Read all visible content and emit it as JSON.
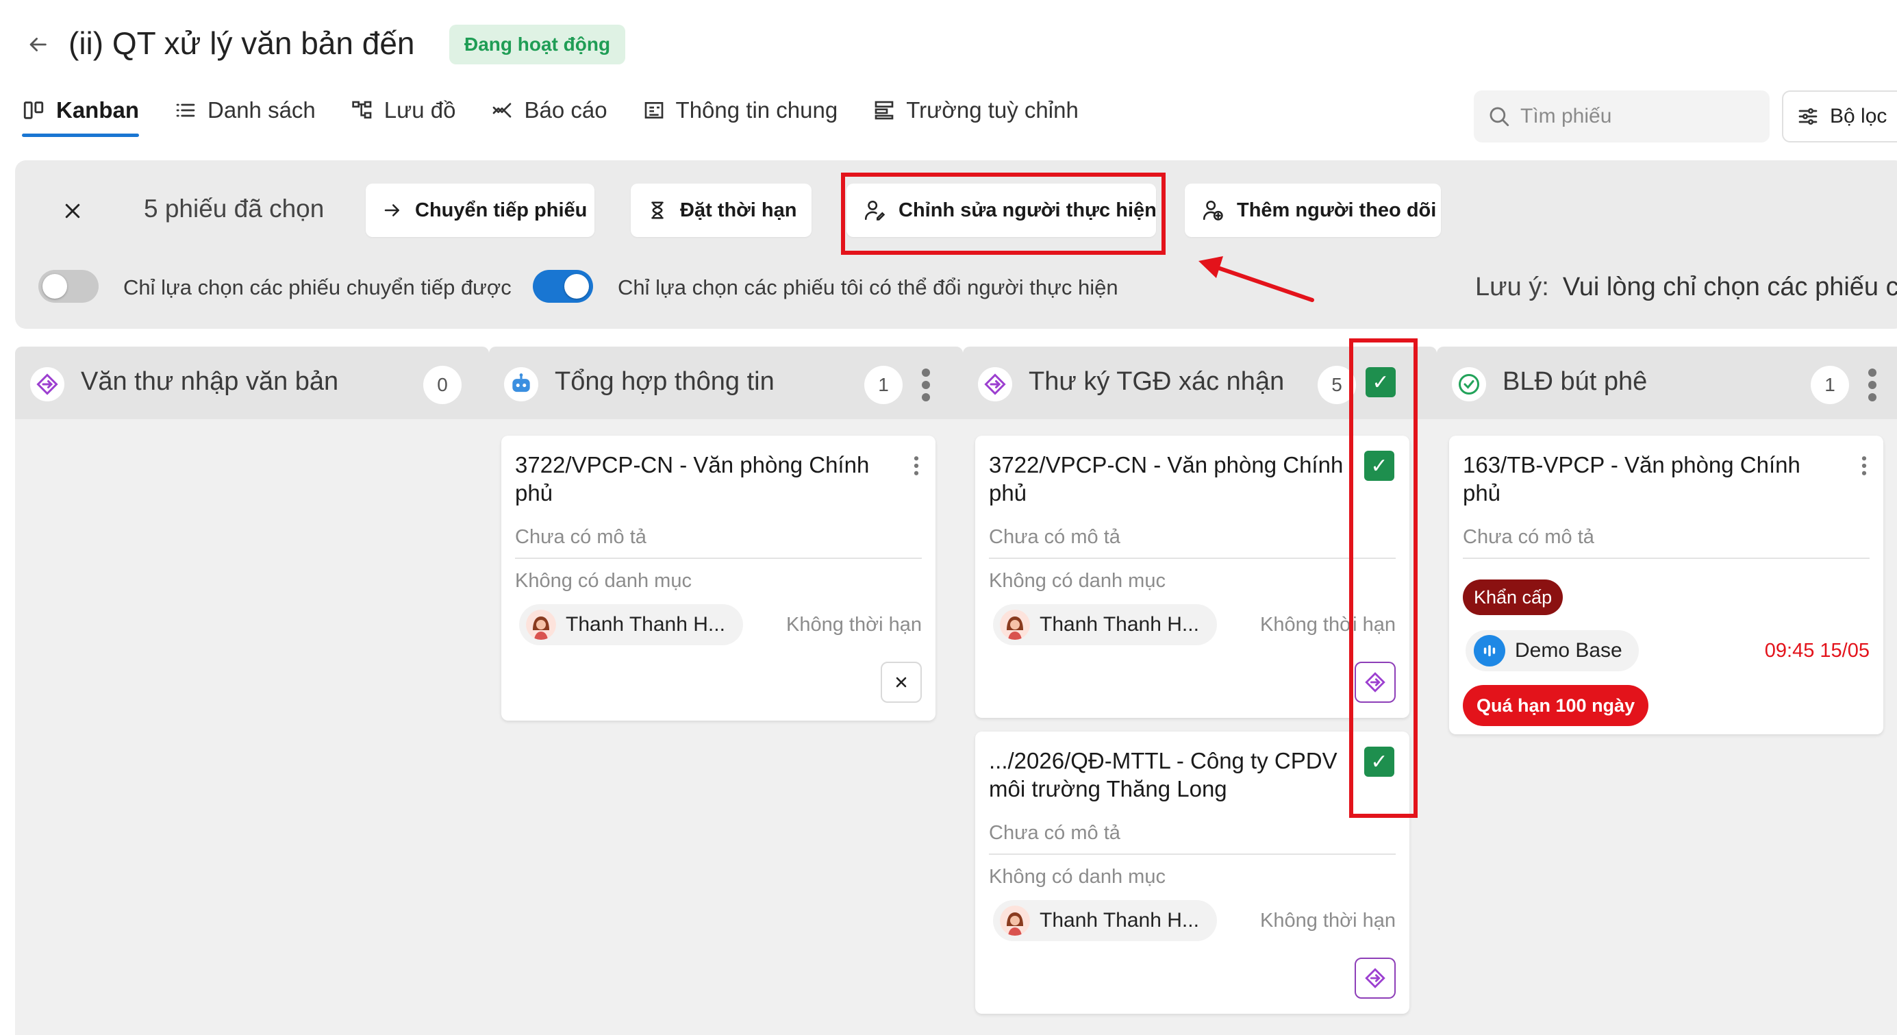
{
  "header": {
    "title": "(ii) QT xử lý văn bản đến",
    "status": "Đang hoạt động"
  },
  "tabs": [
    {
      "label": "Kanban",
      "icon": "kanban-icon",
      "active": true
    },
    {
      "label": "Danh sách",
      "icon": "list-icon"
    },
    {
      "label": "Lưu đồ",
      "icon": "flowchart-icon"
    },
    {
      "label": "Báo cáo",
      "icon": "report-icon"
    },
    {
      "label": "Thông tin chung",
      "icon": "info-icon"
    },
    {
      "label": "Trường tuỳ chỉnh",
      "icon": "custom-fields-icon"
    }
  ],
  "search": {
    "placeholder": "Tìm phiếu"
  },
  "filter": {
    "label": "Bộ lọc"
  },
  "selection": {
    "count_label": "5 phiếu đã chọn",
    "actions": {
      "forward": "Chuyển tiếp phiếu",
      "deadline": "Đặt thời hạn",
      "edit_assignee": "Chỉnh sửa người thực hiện",
      "add_follower": "Thêm người theo dõi"
    },
    "toggle_forwardable": {
      "label": "Chỉ lựa chọn các phiếu chuyển tiếp được",
      "on": false
    },
    "toggle_reassignable": {
      "label": "Chỉ lựa chọn các phiếu tôi có thể đổi người thực hiện",
      "on": true
    },
    "note_label": "Lưu ý:",
    "note_text": "Vui lòng chỉ chọn các phiếu c"
  },
  "columns": [
    {
      "title": "Văn thư nhập văn bản",
      "count": "0",
      "cards": []
    },
    {
      "title": "Tổng hợp thông tin",
      "count": "1",
      "cards": [
        {
          "title": "3722/VPCP-CN - Văn phòng Chính phủ",
          "desc": "Chưa có mô tả",
          "category": "Không có danh mục",
          "assignee": "Thanh Thanh H...",
          "due": "Không thời hạn"
        }
      ]
    },
    {
      "title": "Thư ký TGĐ xác nhận",
      "count": "5",
      "selected": true,
      "cards": [
        {
          "title": "3722/VPCP-CN - Văn phòng Chính phủ",
          "desc": "Chưa có mô tả",
          "category": "Không có danh mục",
          "assignee": "Thanh Thanh H...",
          "due": "Không thời hạn",
          "selected": true
        },
        {
          "title": ".../2026/QĐ-MTTL - Công ty CPDV môi trường Thăng Long",
          "desc": "Chưa có mô tả",
          "category": "Không có danh mục",
          "assignee": "Thanh Thanh H...",
          "due": "Không thời hạn",
          "selected": true
        }
      ]
    },
    {
      "title": "BLĐ bút phê",
      "count": "1",
      "cards": [
        {
          "title": "163/TB-VPCP - Văn phòng Chính phủ",
          "desc": "Chưa có mô tả",
          "tag": "Khẩn cấp",
          "assignee": "Demo Base",
          "due": "09:45 15/05",
          "overdue": "Quá hạn 100 ngày"
        }
      ]
    }
  ],
  "colors": {
    "accent": "#1976d2",
    "highlight": "#e3131b",
    "check": "#1e8f4e",
    "status_bg": "#dff2e4",
    "status_fg": "#1f9d55"
  }
}
